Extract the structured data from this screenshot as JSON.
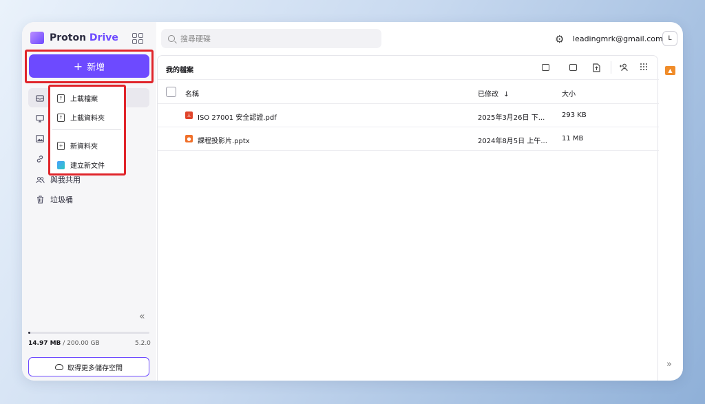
{
  "brand": {
    "name_part1": "Proton",
    "name_part2": " Drive"
  },
  "sidebar": {
    "new_button": {
      "icon": "+",
      "label": "新增"
    },
    "items": [
      {
        "icon": "drive-icon",
        "label": ""
      },
      {
        "icon": "computer-icon",
        "label": ""
      },
      {
        "icon": "photos-icon",
        "label": ""
      },
      {
        "icon": "link-icon",
        "label": ""
      },
      {
        "icon": "shared-icon",
        "label": "與我共用"
      },
      {
        "icon": "trash-icon",
        "label": "垃圾桶"
      }
    ],
    "collapse_glyph": "«",
    "storage": {
      "used": "14.97 MB",
      "separator": " / ",
      "total": "200.00 GB",
      "used_fraction": 0.0001
    },
    "version": "5.2.0",
    "get_more_storage": "取得更多儲存空間"
  },
  "dropdown": {
    "items": [
      {
        "icon": "upload-file-icon",
        "label": "上載檔案"
      },
      {
        "icon": "upload-folder-icon",
        "label": "上載資料夾"
      },
      {
        "icon": "new-folder-icon",
        "label": "新資料夾"
      },
      {
        "icon": "new-document-icon",
        "label": "建立新文件"
      }
    ]
  },
  "topbar": {
    "search_placeholder": "搜尋硬碟",
    "email": "leadingmrk@gmail.com",
    "avatar_letter": "L"
  },
  "main": {
    "title": "我的檔案",
    "columns": {
      "name": "名稱",
      "modified": "已修改",
      "sort_glyph": "↓",
      "size": "大小"
    },
    "files": [
      {
        "type": "pdf",
        "icon_color": "#e0442a",
        "name": "ISO 27001 安全認證.pdf",
        "modified": "2025年3月26日 下...",
        "size": "293 KB"
      },
      {
        "type": "pptx",
        "icon_color": "#f0702a",
        "name": "課程投影片.pptx",
        "modified": "2024年8月5日 上午...",
        "size": "11 MB"
      }
    ]
  },
  "rail": {
    "expand_glyph": "»"
  }
}
